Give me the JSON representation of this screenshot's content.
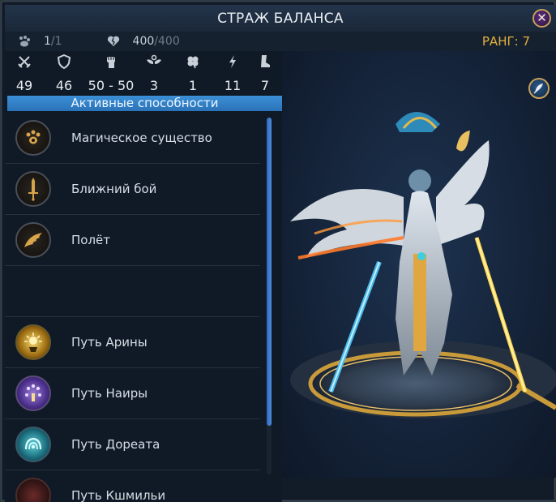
{
  "window": {
    "title": "СТРАЖ БАЛАНСА",
    "close_icon": "close-icon"
  },
  "resources": {
    "units": {
      "icon": "paw-group-icon",
      "current": "1",
      "max": "/1"
    },
    "health": {
      "icon": "heart-crack-icon",
      "current": "400",
      "max": "/400"
    },
    "rank": "РАНГ: 7"
  },
  "stats": [
    {
      "icon": "crossed-swords-icon",
      "value": "49"
    },
    {
      "icon": "shield-icon",
      "value": "46"
    },
    {
      "icon": "fist-icon",
      "value": "50 - 50"
    },
    {
      "icon": "wings-icon",
      "value": "3"
    },
    {
      "icon": "clover-icon",
      "value": "1"
    },
    {
      "icon": "lightning-icon",
      "value": "11"
    },
    {
      "icon": "boot-icon",
      "value": "7"
    }
  ],
  "abilities": {
    "header": "Активные способности",
    "items": [
      {
        "icon": "paw-icon",
        "label": "Магическое существо"
      },
      {
        "icon": "sword-icon",
        "label": "Ближний бой"
      },
      {
        "icon": "wing-icon",
        "label": "Полёт"
      },
      {
        "icon": "",
        "label": ""
      },
      {
        "icon": "arina-path-icon",
        "label": "Путь Арины"
      },
      {
        "icon": "naira-path-icon",
        "label": "Путь Наиры"
      },
      {
        "icon": "doreat-path-icon",
        "label": "Путь Дореата"
      },
      {
        "icon": "kshmili-path-icon",
        "label": "Путь Кшмильи"
      }
    ]
  },
  "colors": {
    "accent_blue": "#3b8fd6",
    "rank_gold": "#e3b03e",
    "frame_gold": "#c8a05a"
  }
}
